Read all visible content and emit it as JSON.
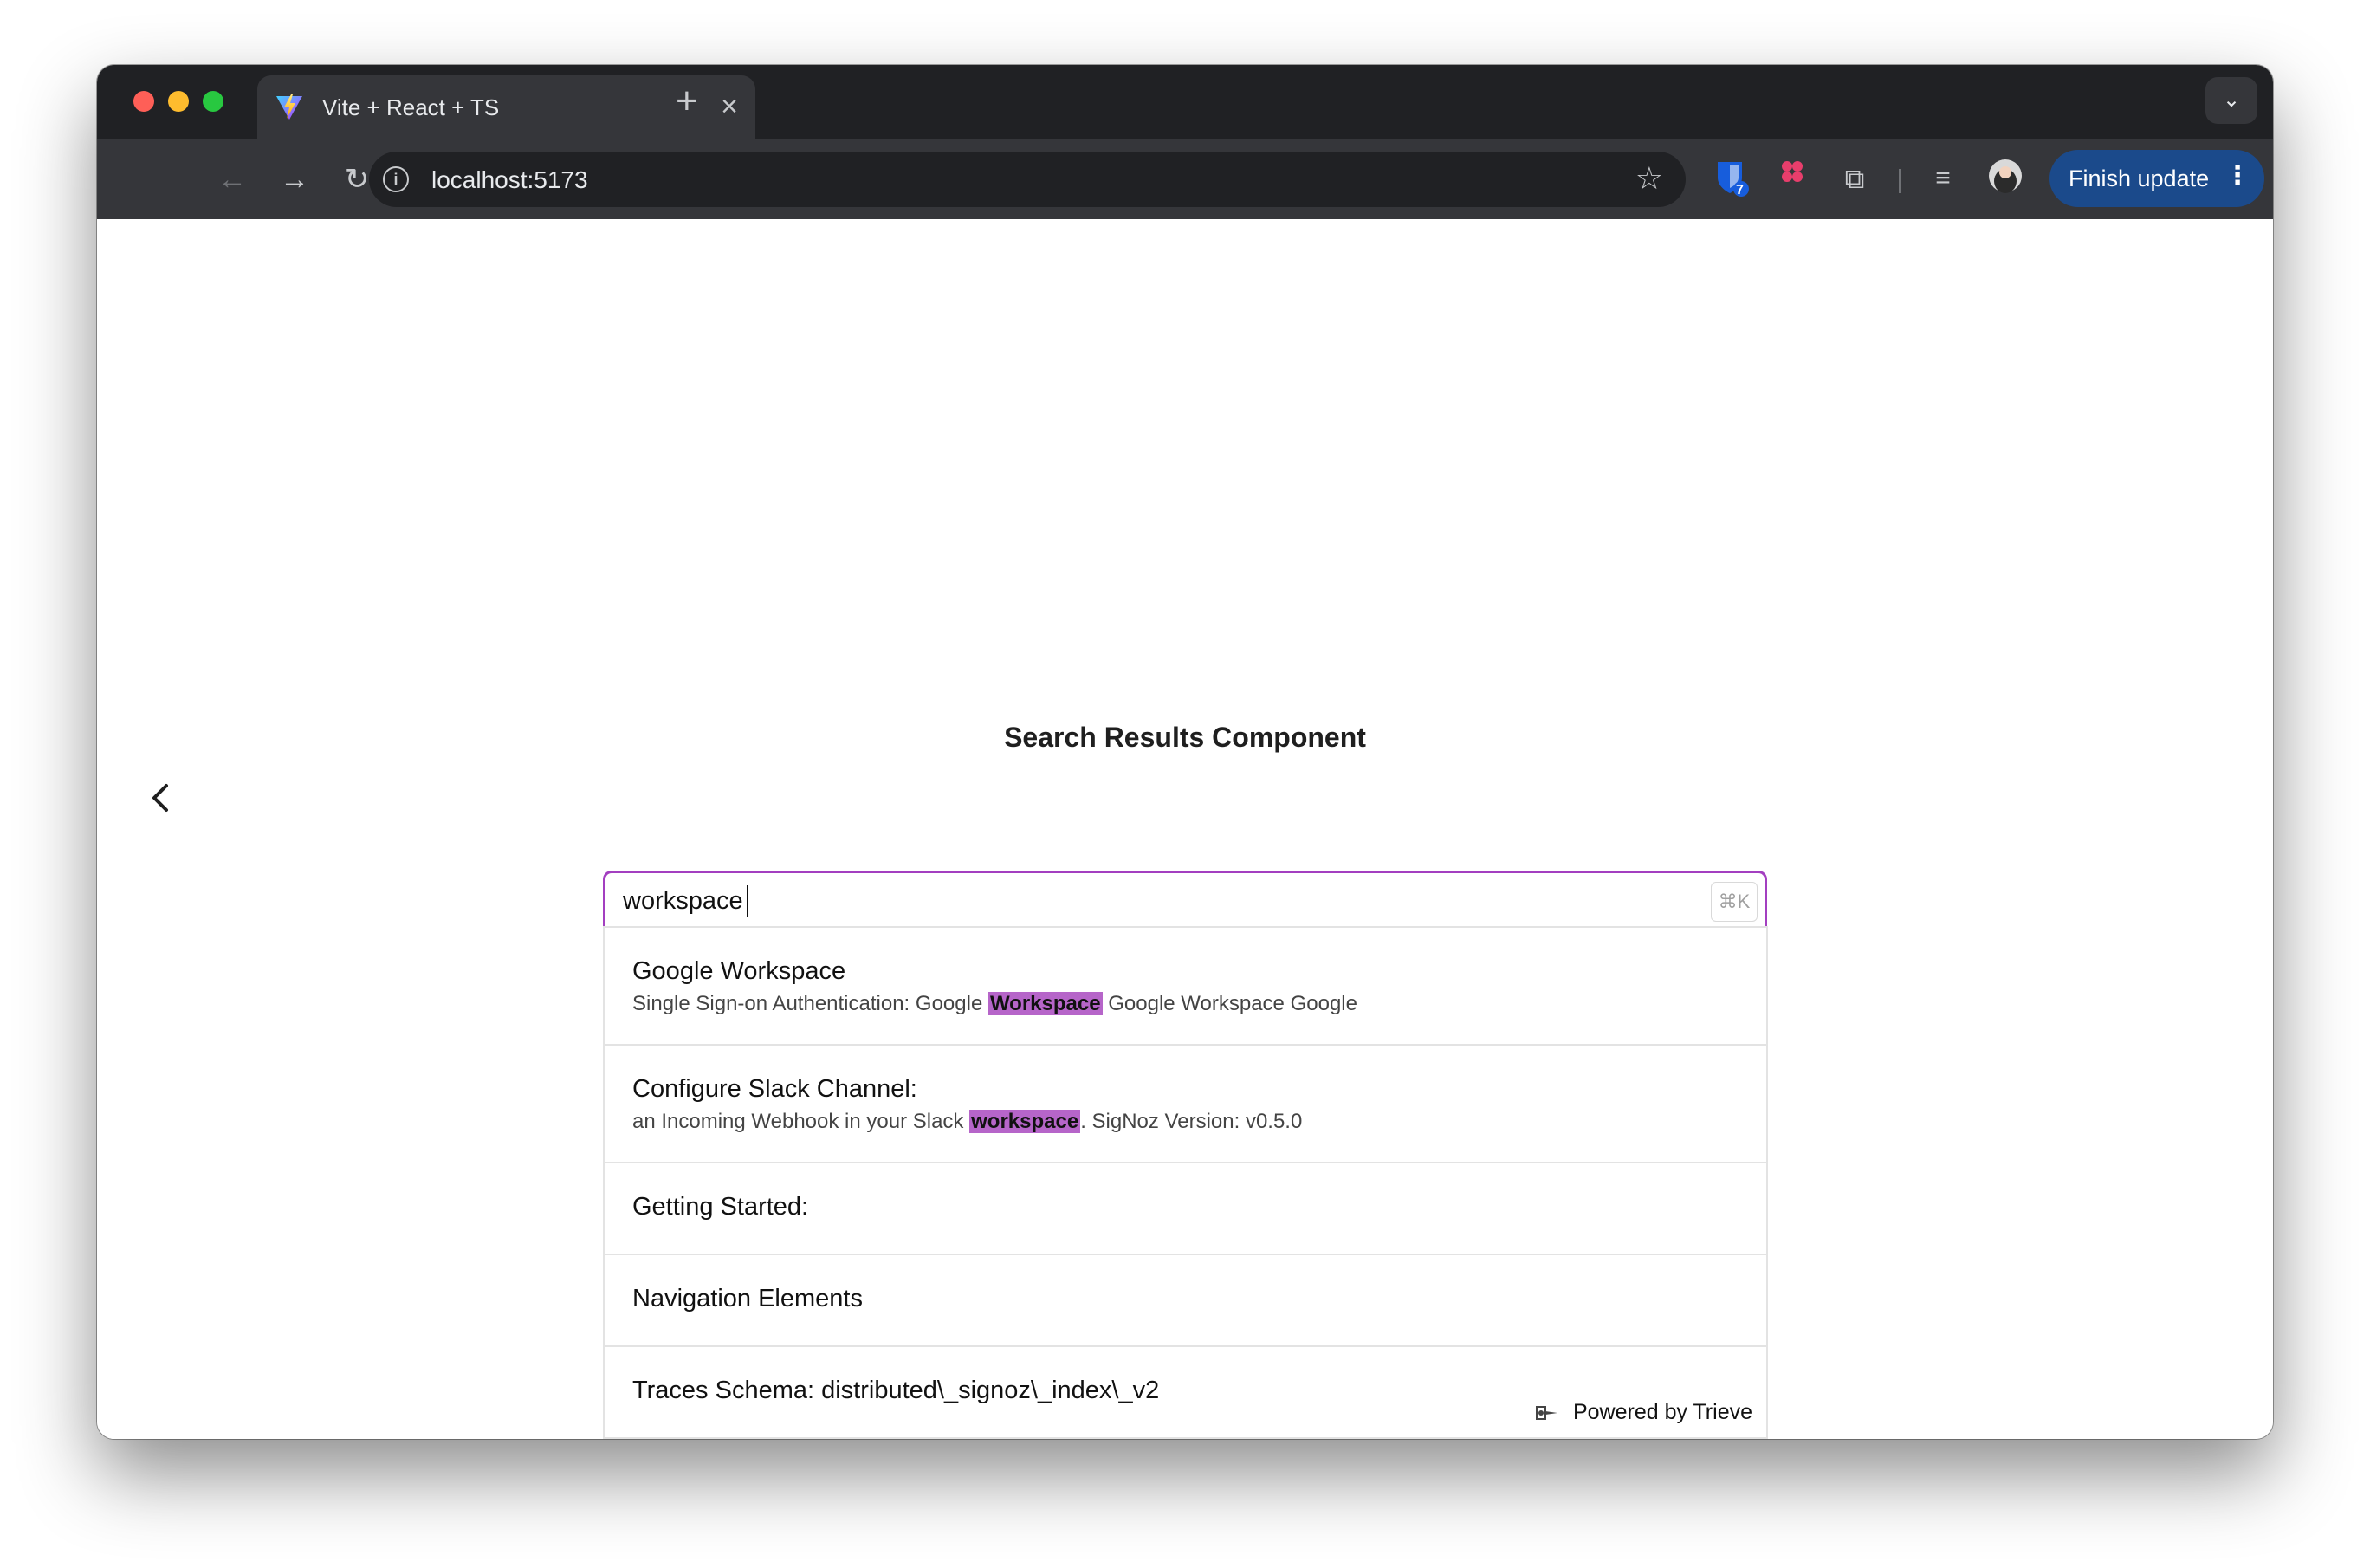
{
  "browser": {
    "tab_title": "Vite + React + TS",
    "url": "localhost:5173",
    "extension_badge": "7",
    "update_button": "Finish update"
  },
  "page": {
    "title": "Search Results Component"
  },
  "search": {
    "query": "workspace",
    "shortcut": "⌘K"
  },
  "results": [
    {
      "title": "Google Workspace",
      "snippet_before": "Single Sign-on Authentication: Google ",
      "snippet_highlight": "Workspace",
      "snippet_after": " Google Workspace Google"
    },
    {
      "title": "Configure Slack Channel:",
      "snippet_before": "an Incoming Webhook in your Slack ",
      "snippet_highlight": "workspace",
      "snippet_after": ". SigNoz Version: v0.5.0"
    },
    {
      "title": "Getting Started:"
    },
    {
      "title": "Navigation Elements"
    },
    {
      "title": "Traces Schema: distributed\\_signoz\\_index\\_v2"
    }
  ],
  "footer": {
    "powered_by": "Powered by Trieve"
  },
  "colors": {
    "accent": "#a33fc0",
    "highlight": "#b665c9",
    "update_button": "#1b4a8b"
  }
}
